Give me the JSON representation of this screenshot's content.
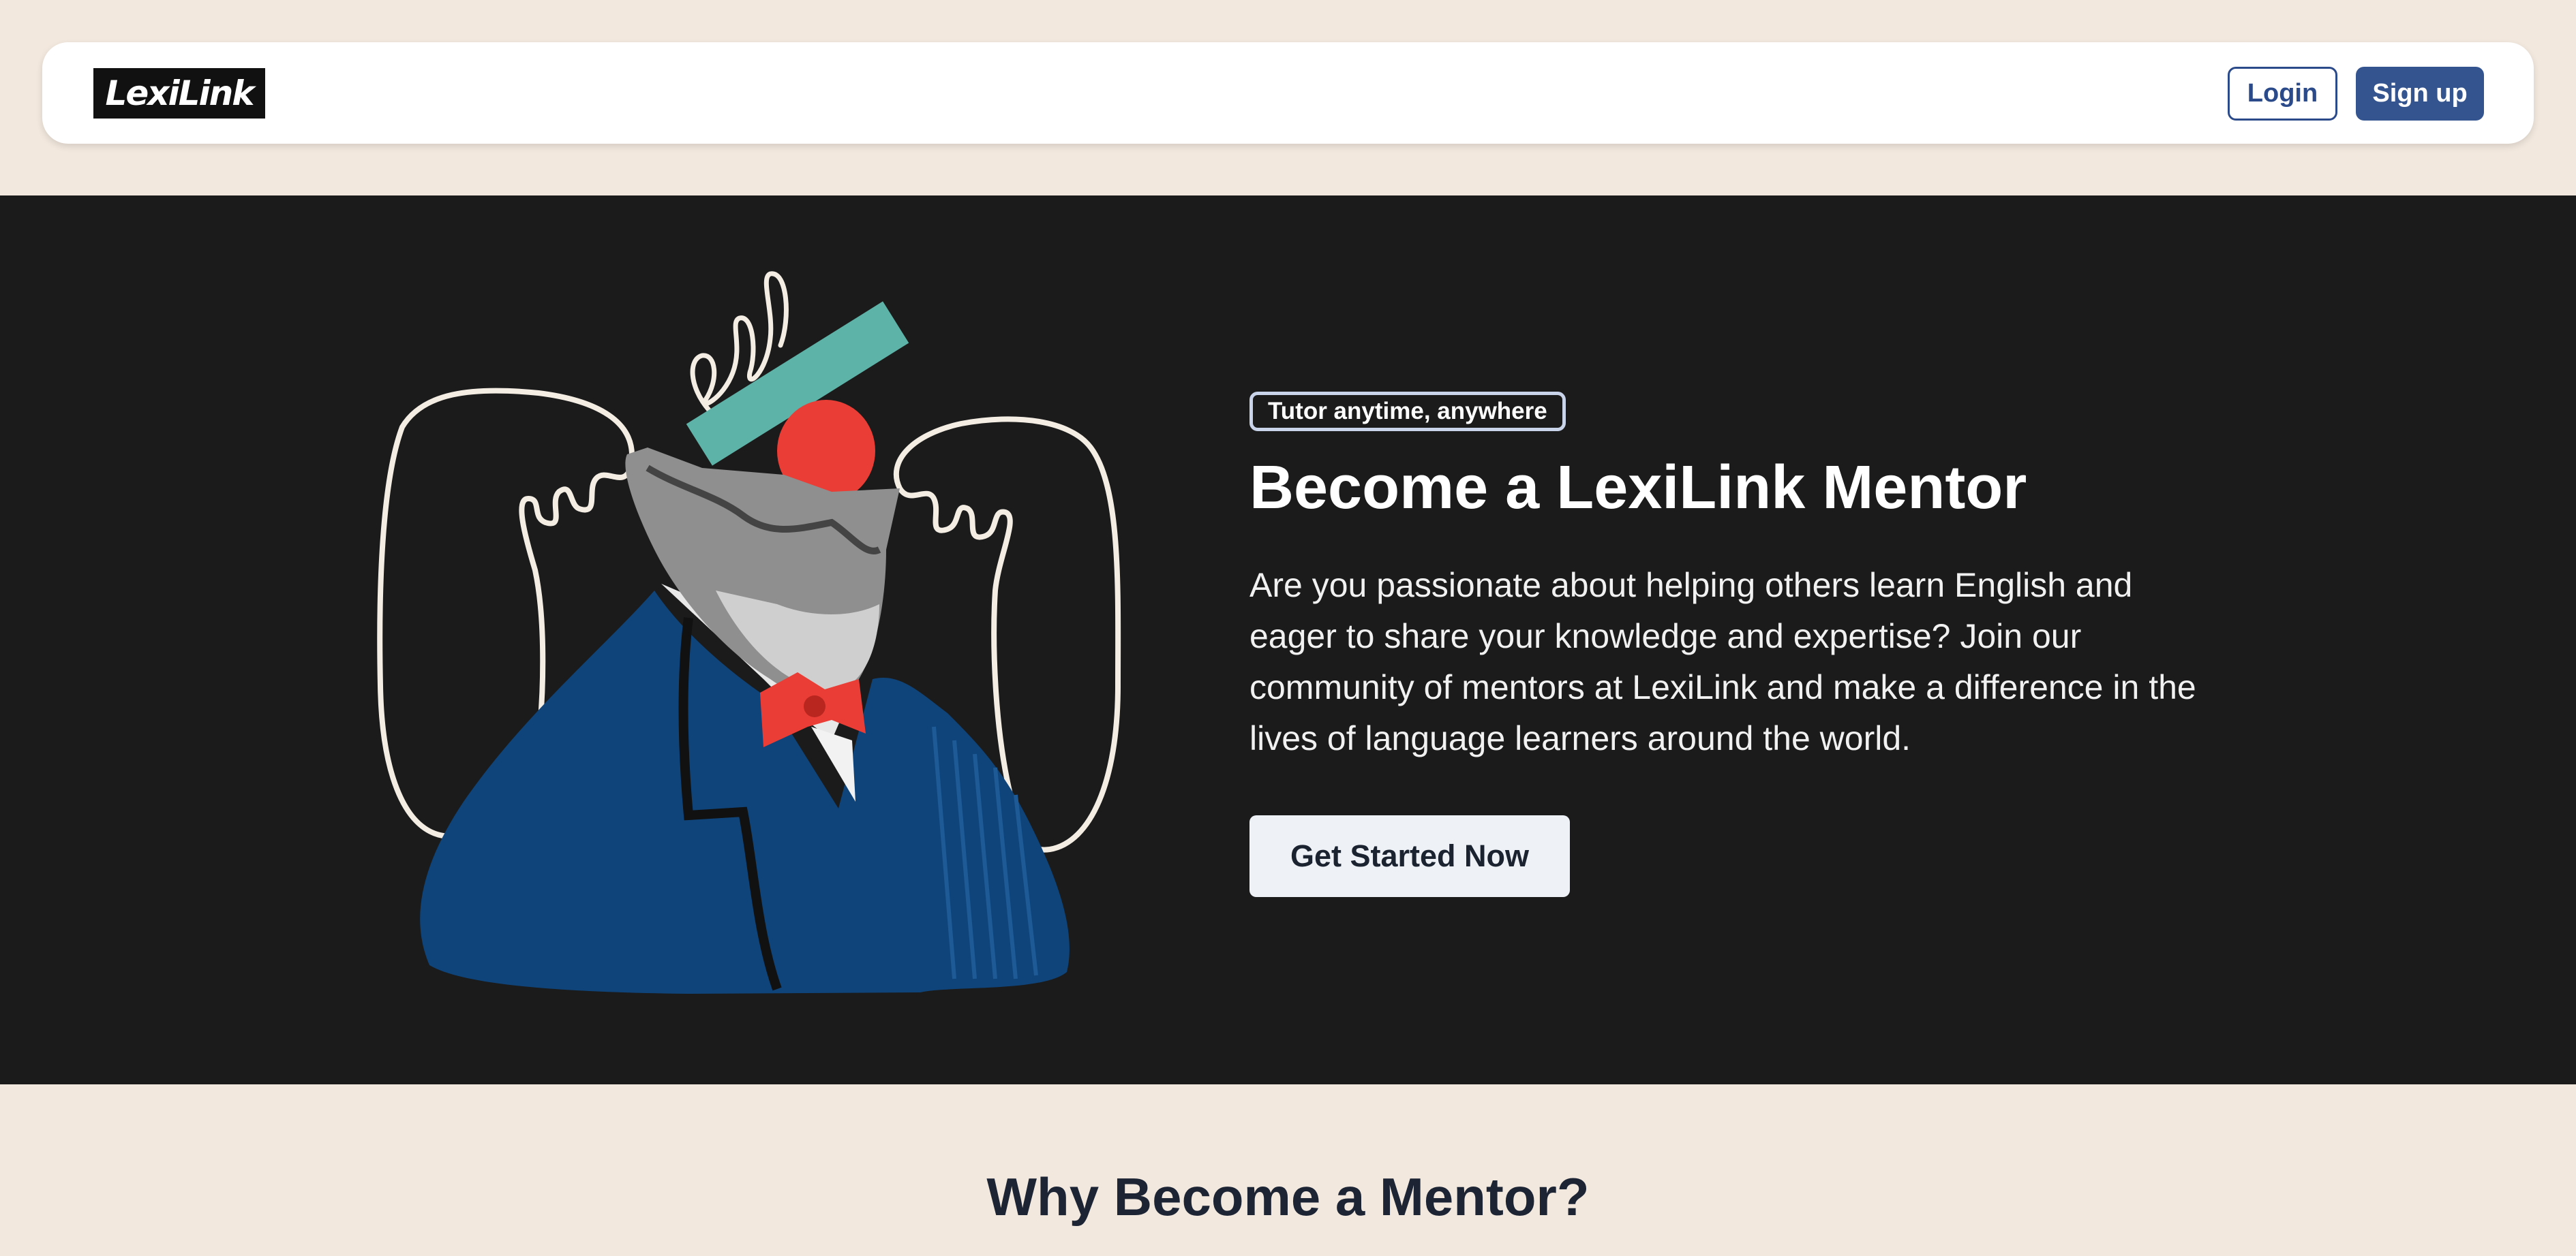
{
  "header": {
    "logo_text": "LexiLink",
    "login_label": "Login",
    "signup_label": "Sign up"
  },
  "hero": {
    "badge": "Tutor anytime, anywhere",
    "title": "Become a LexiLink Mentor",
    "description": "Are you passionate about helping others learn English and eager to share your knowledge and expertise? Join our community of mentors at LexiLink and make a difference in the lives of language learners around the world.",
    "cta_label": "Get Started Now"
  },
  "why": {
    "title": "Why Become a Mentor?"
  },
  "colors": {
    "page_bg": "#f2e8de",
    "hero_bg": "#1b1b1b",
    "brand_blue": "#34548f",
    "jacket_blue": "#0f447a",
    "accent_red": "#ea3d35",
    "accent_teal": "#5eb3a8"
  }
}
